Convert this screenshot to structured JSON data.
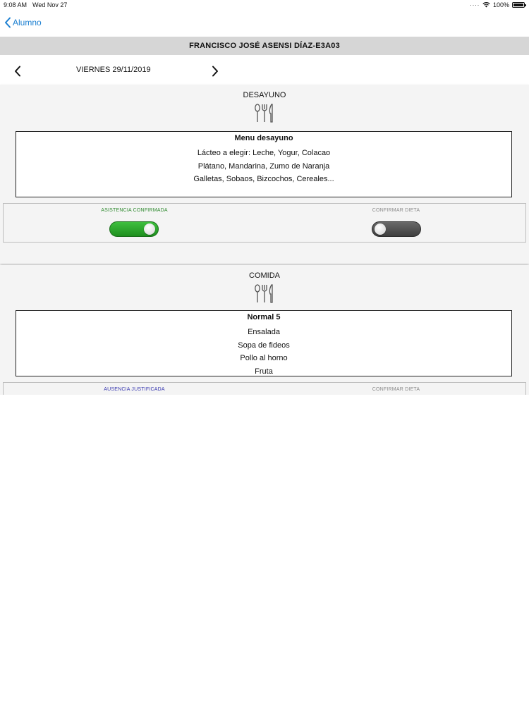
{
  "status_bar": {
    "time": "9:08 AM",
    "date": "Wed Nov 27",
    "battery": "100%"
  },
  "nav": {
    "back_label": "Alumno"
  },
  "student": {
    "name": "FRANCISCO JOSÉ ASENSI DÍAZ-E3A03"
  },
  "date_nav": {
    "label": "VIERNES 29/11/2019"
  },
  "colors": {
    "link_blue": "#1b7fd1",
    "confirmed_green": "#2f8a2f",
    "justified_blue": "#3a3ab0",
    "header_bg": "#d6d6d6"
  },
  "meals": [
    {
      "title": "DESAYUNO",
      "icon": "cutlery-icon",
      "menu_name": "Menu desayuno",
      "items": [
        "Lácteo a elegir: Leche, Yogur, Colacao",
        "Plátano, Mandarina, Zumo de Naranja",
        "Galletas, Sobaos, Bizcochos, Cereales..."
      ],
      "attendance_label": "ASISTENCIA CONFIRMADA",
      "attendance_on": true,
      "diet_label": "CONFIRMAR DIETA",
      "diet_on": false
    },
    {
      "title": "COMIDA",
      "icon": "cutlery-icon",
      "menu_name": "Normal 5",
      "items": [
        "Ensalada",
        "Sopa de fideos",
        "Pollo al horno",
        "Fruta"
      ],
      "attendance_label": "AUSENCIA JUSTIFICADA",
      "diet_label": "CONFIRMAR DIETA"
    }
  ]
}
